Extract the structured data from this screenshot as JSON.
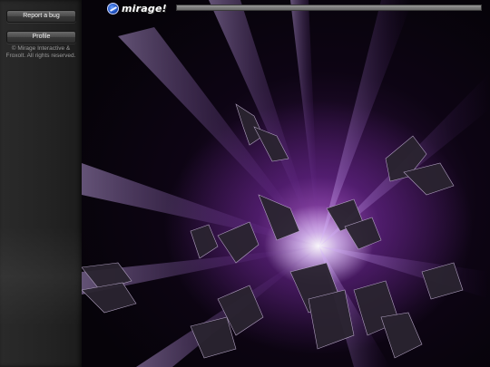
{
  "sidebar": {
    "report_bug_label": "Report a bug",
    "profile_label": "Profile",
    "copyright": "© Mirage Interactive & Froxolt. All rights reserved."
  },
  "header": {
    "logo_text": "mirage!",
    "logo_icon": "mirage-logo-icon"
  },
  "colors": {
    "accent_purple": "#9b4fc8",
    "sidebar_bg": "#232323",
    "header_bar": "#7d7d7d"
  }
}
